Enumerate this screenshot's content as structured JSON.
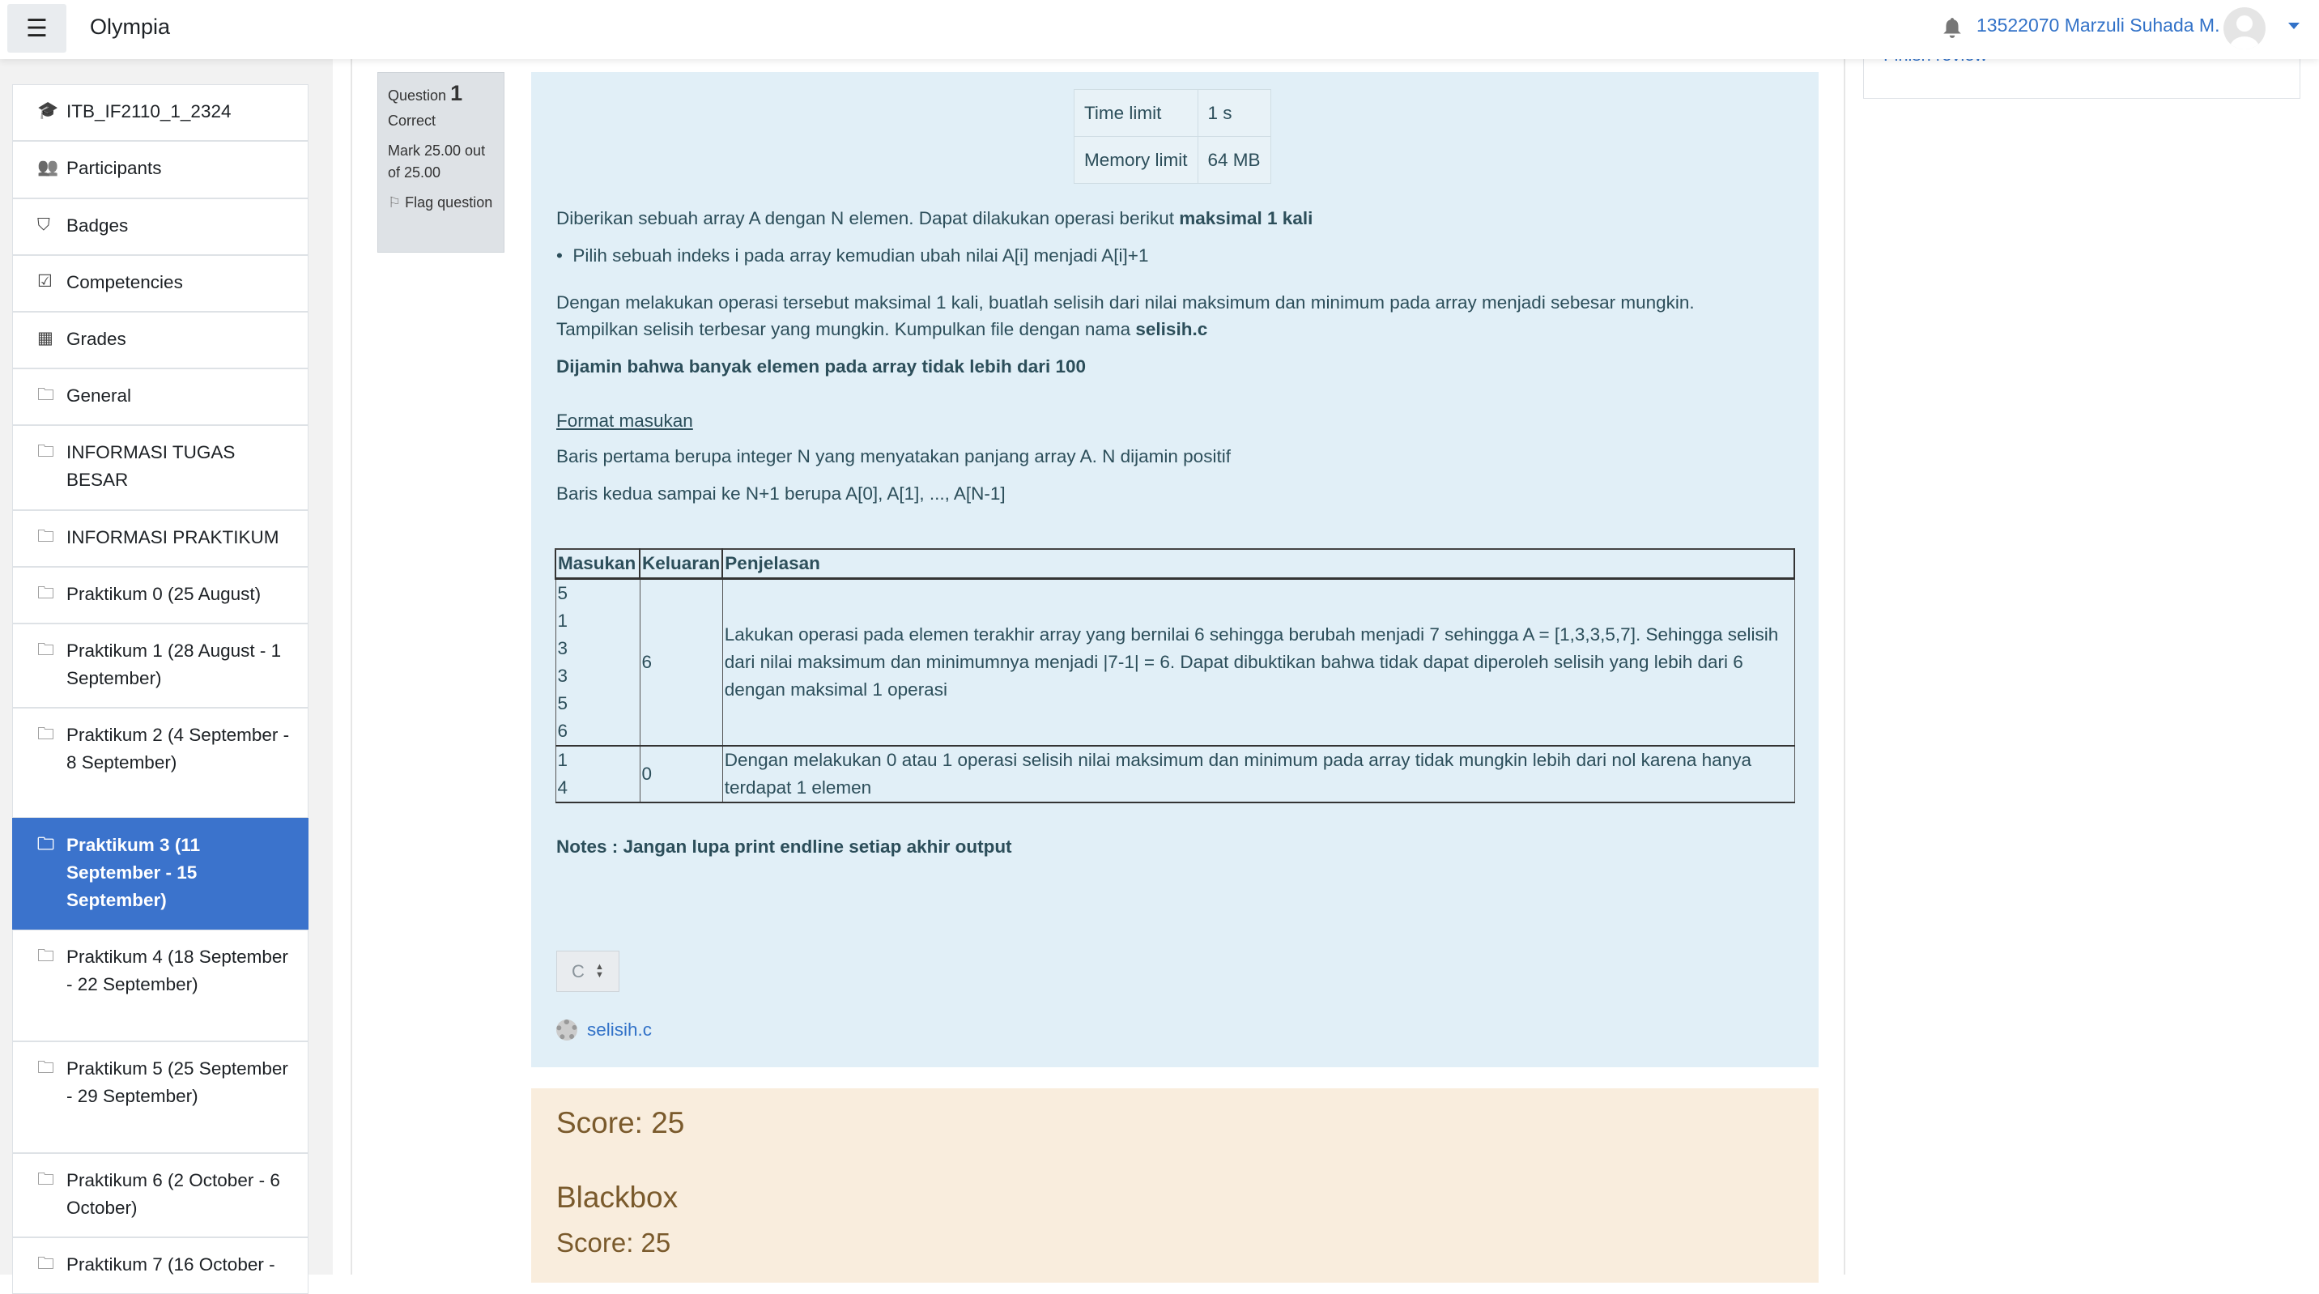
{
  "navbar": {
    "brand": "Olympia",
    "user_name": "13522070 Marzuli Suhada M.",
    "menu_icon": "hamburger-icon",
    "notification_icon": "bell-icon"
  },
  "sidebar": {
    "items": [
      {
        "label": "ITB_IF2110_1_2324",
        "icon": "graduation-cap-icon"
      },
      {
        "label": "Participants",
        "icon": "users-icon"
      },
      {
        "label": "Badges",
        "icon": "shield-icon"
      },
      {
        "label": "Competencies",
        "icon": "check-square-icon"
      },
      {
        "label": "Grades",
        "icon": "table-icon"
      },
      {
        "label": "General",
        "icon": "folder-icon"
      },
      {
        "label": "INFORMASI TUGAS BESAR",
        "icon": "folder-icon"
      },
      {
        "label": "INFORMASI PRAKTIKUM",
        "icon": "folder-icon"
      },
      {
        "label": "Praktikum 0 (25 August)",
        "icon": "folder-icon"
      },
      {
        "label": "Praktikum 1 (28 August - 1 September)",
        "icon": "folder-icon"
      },
      {
        "label": "Praktikum 2 (4 September - 8 September)",
        "icon": "folder-icon"
      },
      {
        "label": "Praktikum 3 (11 September - 15 September)",
        "icon": "folder-icon",
        "active": true
      },
      {
        "label": "Praktikum 4 (18 September - 22 September)",
        "icon": "folder-icon"
      },
      {
        "label": "Praktikum 5 (25 September - 29 September)",
        "icon": "folder-icon"
      },
      {
        "label": "Praktikum 6 (2 October - 6 October)",
        "icon": "folder-icon"
      },
      {
        "label": "Praktikum 7 (16 October -",
        "icon": "folder-icon"
      }
    ]
  },
  "question": {
    "label": "Question",
    "number": "1",
    "status": "Correct",
    "mark": "Mark 25.00 out of 25.00",
    "flag": "Flag question"
  },
  "limits": {
    "time_label": "Time limit",
    "time_value": "1 s",
    "memory_label": "Memory limit",
    "memory_value": "64 MB"
  },
  "content": {
    "p1": "Diberikan sebuah array A dengan N elemen. Dapat dilakukan operasi berikut ",
    "p1_bold": "maksimal 1 kali",
    "bullet": "Pilih sebuah indeks i pada array kemudian ubah nilai A[i] menjadi A[i]+1",
    "p2a": "Dengan melakukan operasi tersebut maksimal 1 kali, buatlah selisih dari nilai maksimum dan minimum pada array menjadi sebesar mungkin.",
    "p2b": "Tampilkan selisih terbesar yang mungkin. Kumpulkan file dengan nama ",
    "p2b_bold": "selisih.c",
    "p3": "Dijamin bahwa banyak elemen pada array tidak lebih dari 100",
    "format_heading": "Format masukan",
    "f1": "Baris pertama berupa integer N yang menyatakan panjang array A. N dijamin positif",
    "f2": "Baris kedua sampai ke N+1 berupa A[0], A[1], ..., A[N-1]",
    "table": {
      "headers": [
        "Masukan",
        "Keluaran",
        "Penjelasan"
      ],
      "rows": [
        {
          "input": [
            "5",
            "1",
            "3",
            "3",
            "5",
            "6"
          ],
          "output": "6",
          "explanation": "Lakukan operasi pada elemen terakhir array yang bernilai 6 sehingga berubah menjadi 7 sehingga A = [1,3,3,5,7]. Sehingga selisih dari nilai maksimum dan minimumnya menjadi |7-1| = 6. Dapat dibuktikan bahwa tidak dapat diperoleh selisih yang lebih dari 6 dengan maksimal 1 operasi"
        },
        {
          "input": [
            "1",
            "4"
          ],
          "output": "0",
          "explanation": "Dengan melakukan 0 atau 1 operasi selisih nilai maksimum dan minimum pada array tidak mungkin lebih dari nol karena hanya terdapat 1 elemen"
        }
      ]
    },
    "notes": "Notes : Jangan lupa print endline setiap akhir output",
    "language": "C",
    "file": "selisih.c"
  },
  "feedback": {
    "score": "Score: 25",
    "blackbox_title": "Blackbox",
    "blackbox_score": "Score: 25"
  },
  "right": {
    "finish_review": "Finish review"
  },
  "colors": {
    "accent": "#3b73cc",
    "info_bg": "#e1eff7",
    "feedback_bg": "#f9eddd"
  }
}
